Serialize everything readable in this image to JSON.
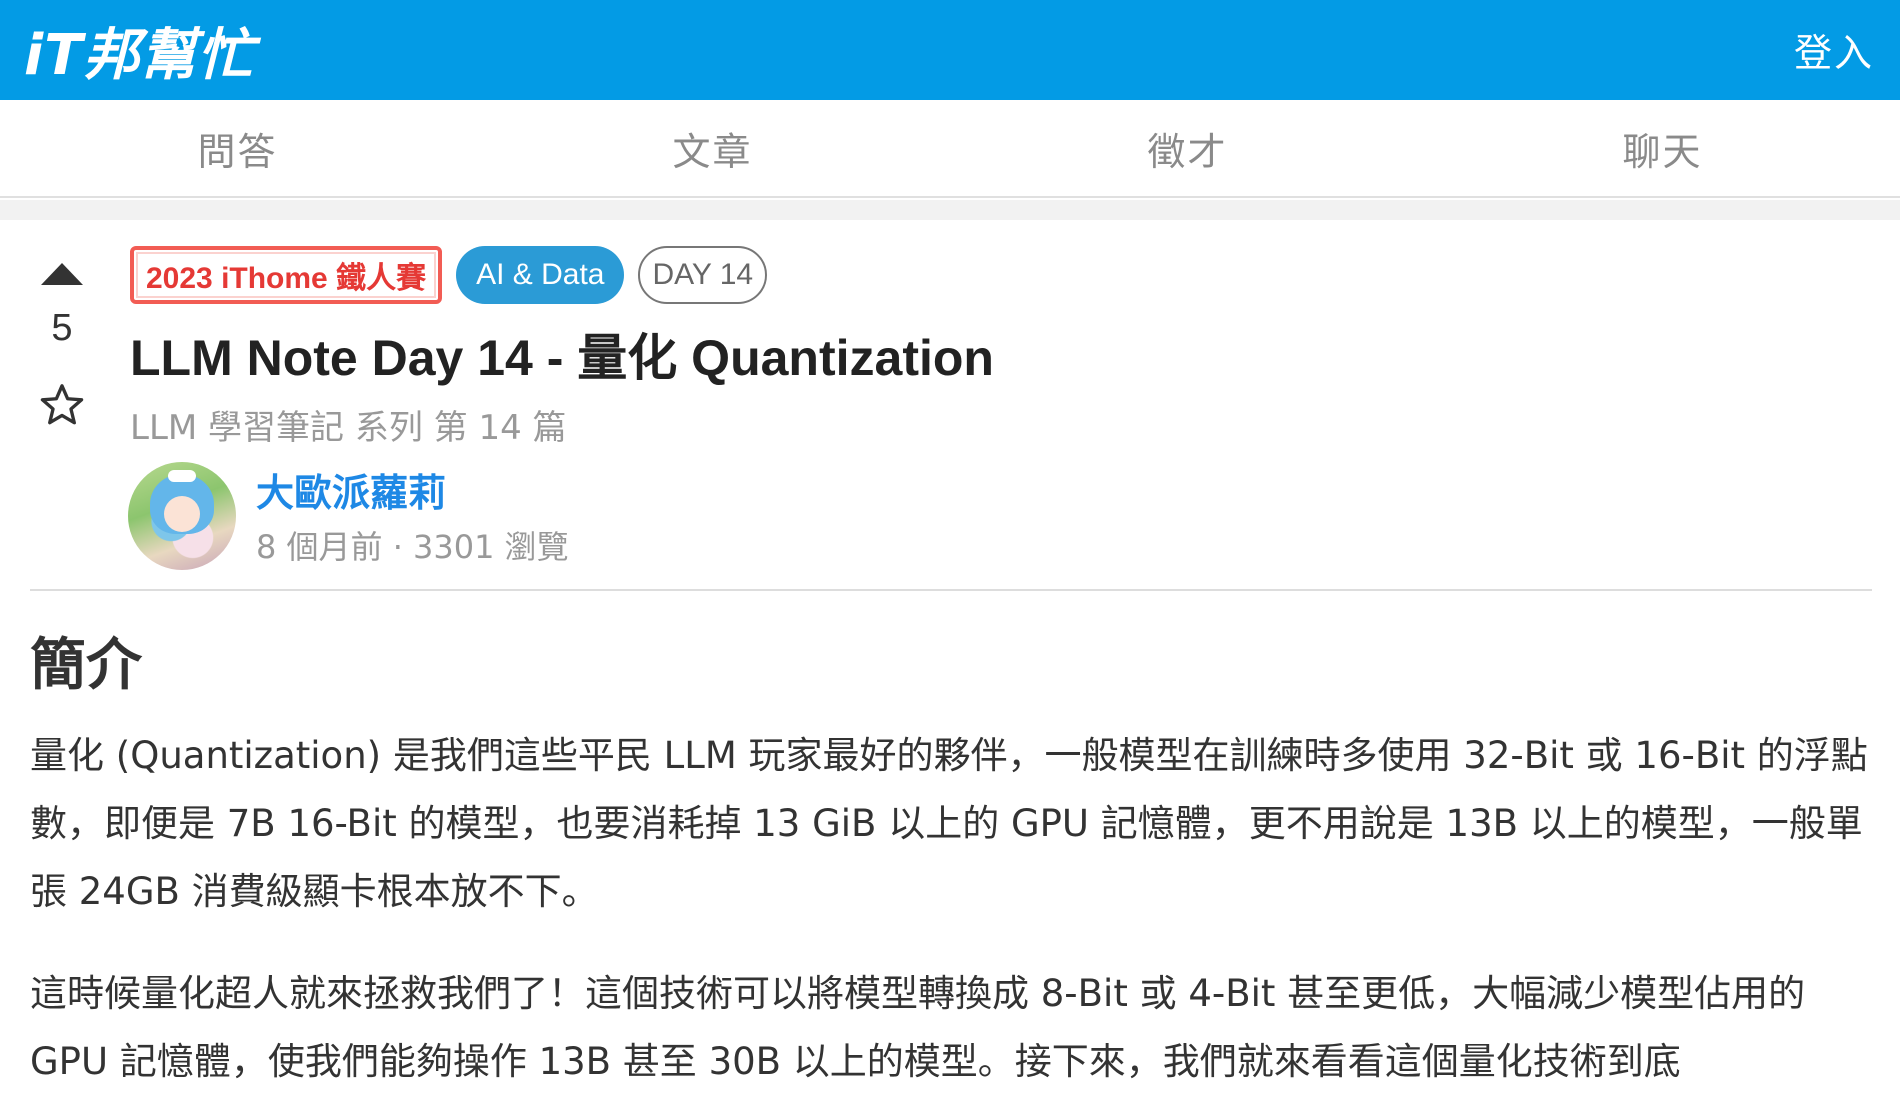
{
  "header": {
    "logo_text": "iT邦幫忙",
    "login_label": "登入"
  },
  "nav": {
    "items": [
      {
        "label": "問答"
      },
      {
        "label": "文章"
      },
      {
        "label": "徵才"
      },
      {
        "label": "聊天"
      }
    ]
  },
  "article": {
    "vote_count": "5",
    "tags": {
      "ironman": "2023 iThome 鐵人賽",
      "category": "AI & Data",
      "day": "DAY 14"
    },
    "title": "LLM Note Day 14 - 量化 Quantization",
    "series": "LLM 學習筆記 系列 第 14 篇",
    "author": "大歐派蘿莉",
    "meta": "8 個月前 · 3301 瀏覽",
    "section_title": "簡介",
    "paragraphs": [
      "量化 (Quantization) 是我們這些平民 LLM 玩家最好的夥伴，一般模型在訓練時多使用 32-Bit 或 16-Bit 的浮點數，即便是 7B 16-Bit 的模型，也要消耗掉 13 GiB 以上的 GPU 記憶體，更不用說是 13B 以上的模型，一般單張 24GB 消費級顯卡根本放不下。",
      "這時候量化超人就來拯救我們了！這個技術可以將模型轉換成 8-Bit 或 4-Bit 甚至更低，大幅減少模型佔用的 GPU 記憶體，使我們能夠操作 13B 甚至 30B 以上的模型。接下來，我們就來看看這個量化技術到底"
    ]
  },
  "colors": {
    "brand_blue": "#039be5",
    "ironman_red": "#e53935",
    "category_blue": "#2b9bd6",
    "author_blue": "#1e88e5"
  },
  "icons": {
    "upvote": "upvote-icon",
    "bookmark": "star-icon"
  }
}
